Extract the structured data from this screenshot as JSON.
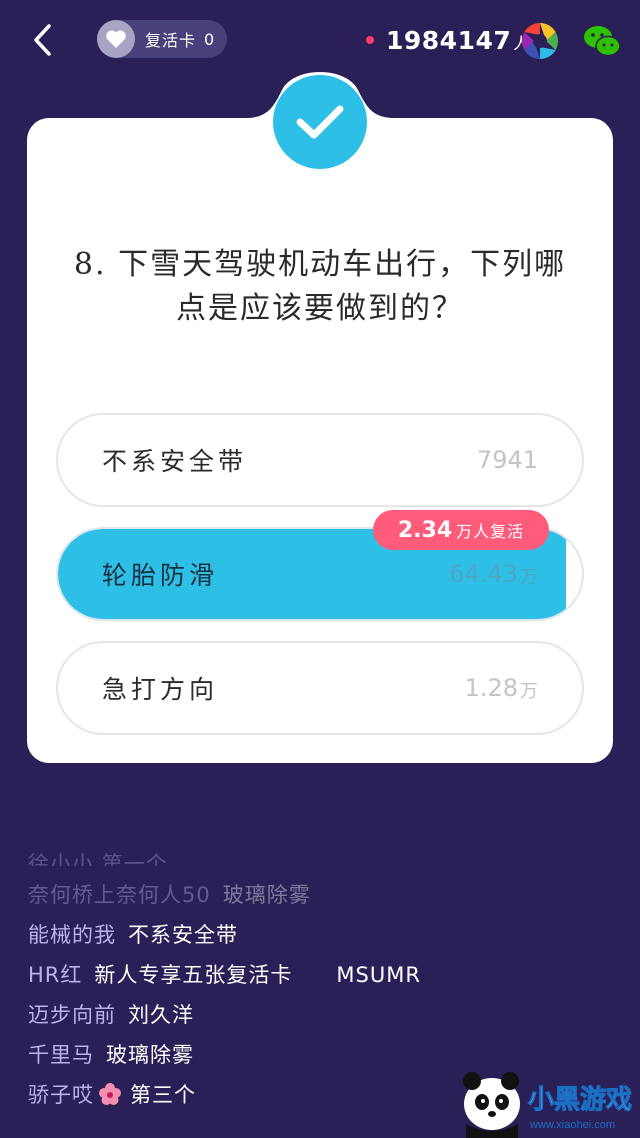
{
  "topbar": {
    "back_icon": "chevron-left-icon",
    "revive_card_label": "复活卡",
    "revive_card_count": "0",
    "online_count": "1984147",
    "online_unit": "人"
  },
  "question": {
    "text": "8. 下雪天驾驶机动车出行，下列哪点是应该要做到的？"
  },
  "options": [
    {
      "label": "不系安全带",
      "count": "7941",
      "unit": ""
    },
    {
      "label": "轮胎防滑",
      "count": "64.43",
      "unit": "万",
      "selected": true
    },
    {
      "label": "急打方向",
      "count": "1.28",
      "unit": "万"
    }
  ],
  "revive_badge": {
    "value": "2.34",
    "unit": "万人复活"
  },
  "chat": [
    {
      "user": "",
      "msg": "",
      "partial": "徐小小 第一个"
    },
    {
      "user": "奈何桥上奈何人50",
      "msg": "玻璃除雾",
      "faded": true
    },
    {
      "user": "能械的我",
      "msg": "不系安全带"
    },
    {
      "user": "HR红",
      "msg": "新人专享五张复活卡　　MSUMR"
    },
    {
      "user": "迈步向前",
      "msg": "刘久洋"
    },
    {
      "user": "千里马",
      "msg": "玻璃除雾"
    },
    {
      "user": "骄子哎",
      "msg": "第三个"
    }
  ],
  "colors": {
    "background": "#2a1f56",
    "accent": "#2dbfe6",
    "badge": "#ff5c7c",
    "online_dot": "#ff3b6b"
  },
  "watermark": {
    "brand": "小黑游戏",
    "url": "www.xiaohei.com"
  }
}
